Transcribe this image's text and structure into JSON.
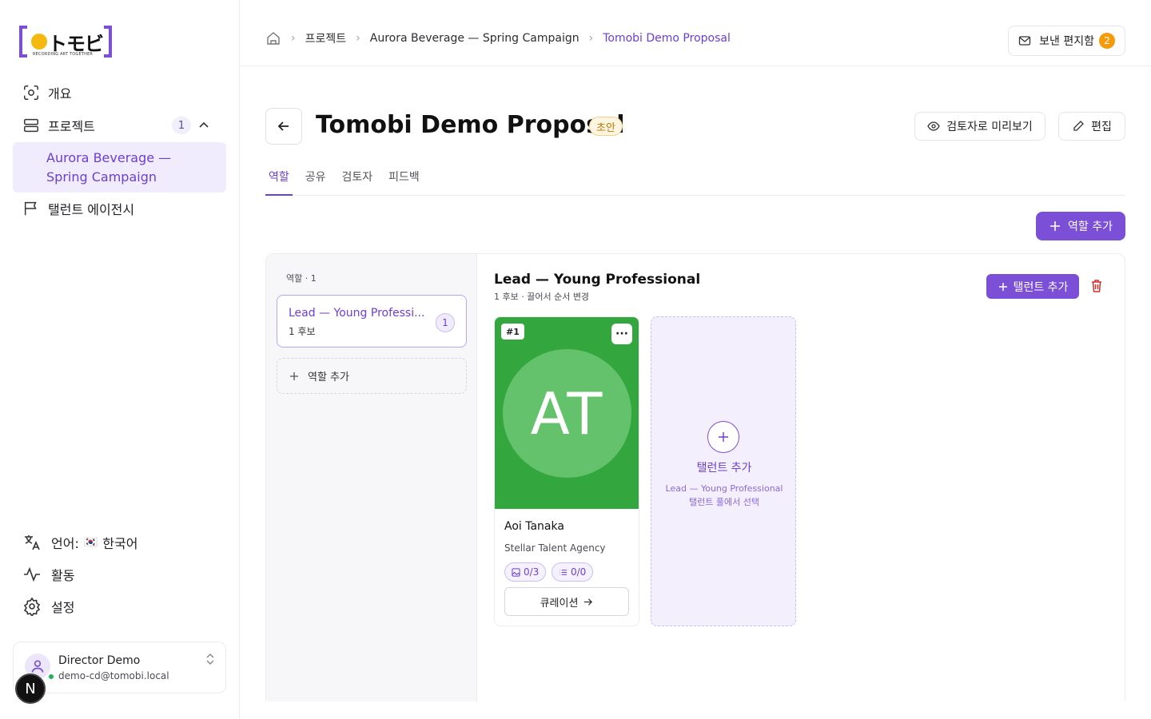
{
  "brand": {
    "logo_word": "トモビ",
    "logo_tagline": "RECORDING ART TOGETHER",
    "accent": "#7b4fd6",
    "logo_dot": "#f5b80f"
  },
  "sidebar": {
    "items": [
      {
        "label": "개요",
        "icon": "overview-icon"
      },
      {
        "label": "프로젝트",
        "icon": "projects-icon",
        "count": "1"
      },
      {
        "label": "탤런트 에이전시",
        "icon": "flag-icon"
      }
    ],
    "active_sub_item": "Aurora Beverage — Spring Campaign",
    "bottom": [
      {
        "label": "언어:",
        "flag": "🇰🇷",
        "value": "한국어",
        "icon": "translate-icon"
      },
      {
        "label": "활동",
        "icon": "activity-icon"
      },
      {
        "label": "설정",
        "icon": "settings-icon"
      }
    ],
    "user": {
      "name": "Director Demo",
      "email": "demo-cd@tomobi.local"
    },
    "dev_badge": "N"
  },
  "header": {
    "breadcrumb": [
      "프로젝트",
      "Aurora Beverage — Spring Campaign",
      "Tomobi Demo Proposal"
    ],
    "outbox_label": "보낸 편지함",
    "outbox_count": "2"
  },
  "page": {
    "title": "Tomobi Demo Proposal",
    "status": "초안",
    "preview_label": "검토자로 미리보기",
    "edit_label": "편집",
    "tabs": [
      "역할",
      "공유",
      "검토자",
      "피드백"
    ],
    "add_role_label": "역할 추가"
  },
  "roles": {
    "header": "역할 · 1",
    "items": [
      {
        "title": "Lead — Young Professi...",
        "subtitle": "1 후보",
        "count": "1"
      }
    ],
    "add_label": "역할 추가"
  },
  "role_detail": {
    "title": "Lead — Young Professional",
    "subtitle": "1 후보 · 끌어서 순서 변경",
    "add_talent_label": "탤런트 추가",
    "talents": [
      {
        "rank": "#1",
        "initials": "AT",
        "name": "Aoi Tanaka",
        "agency": "Stellar Talent Agency",
        "photos": "0/3",
        "notes": "0/0",
        "action_label": "큐레이션",
        "photo_bg": "#33a73e"
      }
    ],
    "add_slot": {
      "title": "탤런트 추가",
      "description": "Lead — Young Professional 탤런트 풀에서 선택"
    }
  }
}
